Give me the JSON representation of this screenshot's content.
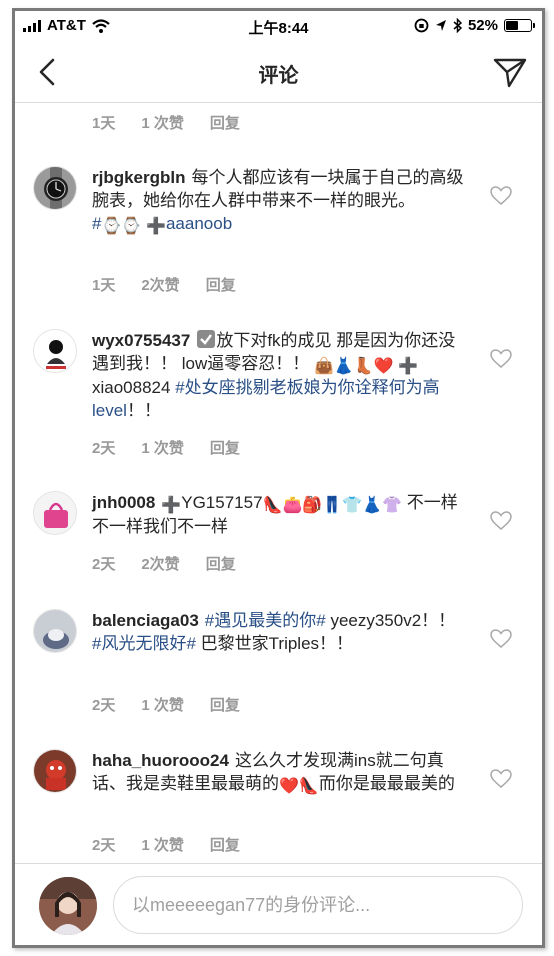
{
  "status_bar": {
    "carrier": "AT&T",
    "time": "上午8:44",
    "battery": "52%",
    "battery_level": 0.52
  },
  "nav": {
    "title": "评论"
  },
  "top_meta": {
    "time": "1天",
    "likes": "1 次赞",
    "reply": "回复"
  },
  "comments": [
    {
      "username": "rjbgkergbln",
      "text": "每个人都应该有一块属于自己的高级腕表，她给你在人群中带来不一样的眼光。",
      "hashtag": "#",
      "emojis": "⌚⌚",
      "plus": "➕",
      "mention": "aaanoob",
      "time": "1天",
      "likes": "2次赞",
      "reply": "回复"
    },
    {
      "username": "wyx0755437",
      "text1": "放下对fk的成见 那是因为你还没遇到我！！ low逼零容忍！！",
      "emojis": "👜👗👢❤️",
      "plus": "➕",
      "mention": "xiao08824",
      "hashtag": "#处女座挑剔老板娘为你诠释何为高level",
      "text2": "！！",
      "check_icon": "check-square-icon",
      "time": "2天",
      "likes": "1 次赞",
      "reply": "回复"
    },
    {
      "username": "jnh0008",
      "plus": "➕",
      "mention": "YG157157",
      "emojis": "👠👛🎒👖👕👗👚",
      "text": "不一样不一样我们不一样",
      "time": "2天",
      "likes": "2次赞",
      "reply": "回复"
    },
    {
      "username": "balenciaga03",
      "hashtag1": "#遇见最美的你#",
      "text1": "yeezy350v2！！",
      "hashtag2": "#风光无限好#",
      "text2": "巴黎世家Triples！！",
      "time": "2天",
      "likes": "1 次赞",
      "reply": "回复"
    },
    {
      "username": "haha_huorooo24",
      "text1": "这么久才发现满ins就二句真话、我是卖鞋里最最萌的",
      "emojis": "❤️👠",
      "text2": "而你是最最最美的",
      "time": "2天",
      "likes": "1 次赞",
      "reply": "回复"
    }
  ],
  "input": {
    "placeholder": "以meeeeegan77的身份评论..."
  },
  "colors": {
    "link": "#2a4f86",
    "meta": "#999999",
    "border": "#dbdbdb"
  }
}
